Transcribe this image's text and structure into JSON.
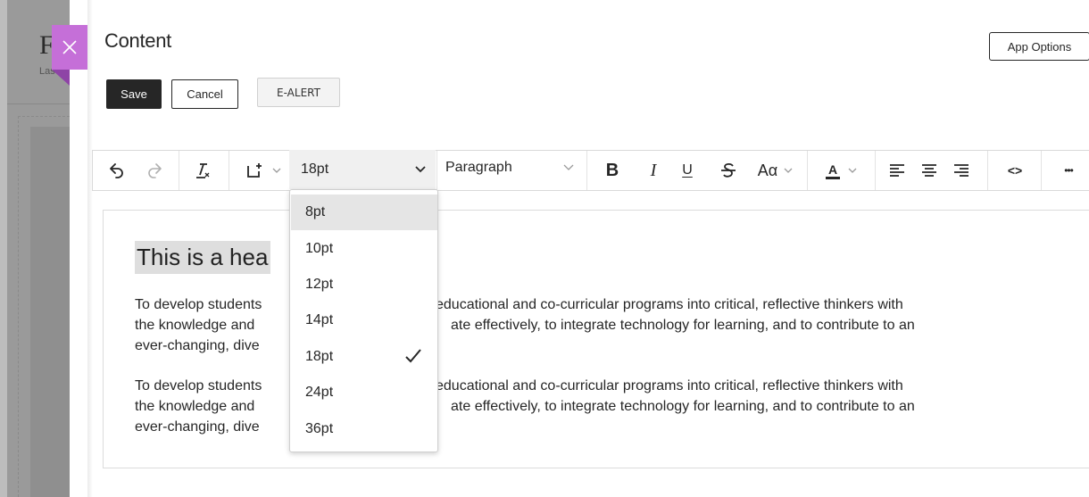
{
  "background": {
    "title_fragment": "F",
    "subtitle_fragment": "Las"
  },
  "panel": {
    "title": "Content",
    "app_options_label": "App Options",
    "save_label": "Save",
    "cancel_label": "Cancel",
    "ealert_label": "E-ALERT"
  },
  "toolbar": {
    "font_size_value": "18pt",
    "paragraph_value": "Paragraph",
    "icons": [
      "undo-icon",
      "redo-icon",
      "clear-formatting-icon",
      "insert-content-icon",
      "bold-icon",
      "italic-icon",
      "underline-icon",
      "strikethrough-icon",
      "text-case-icon",
      "text-color-icon",
      "align-left-icon",
      "align-center-icon",
      "align-right-icon",
      "code-view-icon",
      "more-icon"
    ],
    "bold_glyph": "B",
    "italic_glyph": "I",
    "underline_glyph": "U",
    "case_glyph": "Aα",
    "color_glyph": "A",
    "code_glyph": "<>",
    "more_glyph": "•••"
  },
  "editor": {
    "heading": "This is a hea",
    "paragraph1_line1_left": "To develop students",
    "paragraph1_line1_right": "educational and co-curricular programs into critical, reflective thinkers with",
    "paragraph1_line2_left": "the knowledge and",
    "paragraph1_line2_right": "ate effectively, to integrate technology for learning, and to contribute to an",
    "paragraph1_line3_left": "ever-changing, dive",
    "paragraph2_line1_left": "To develop students",
    "paragraph2_line1_right": "educational and co-curricular programs into critical, reflective thinkers with",
    "paragraph2_line2_left": "the knowledge and",
    "paragraph2_line2_right": "ate effectively, to integrate technology for learning, and to contribute to an",
    "paragraph2_line3_left": "ever-changing, dive"
  },
  "font_size_dropdown": {
    "options": [
      "8pt",
      "10pt",
      "12pt",
      "14pt",
      "18pt",
      "24pt",
      "36pt"
    ],
    "highlighted": "8pt",
    "checked": "18pt"
  },
  "colors": {
    "close_button": "#c56fd8",
    "save_button": "#262626",
    "heading_highlight": "#dedede"
  }
}
